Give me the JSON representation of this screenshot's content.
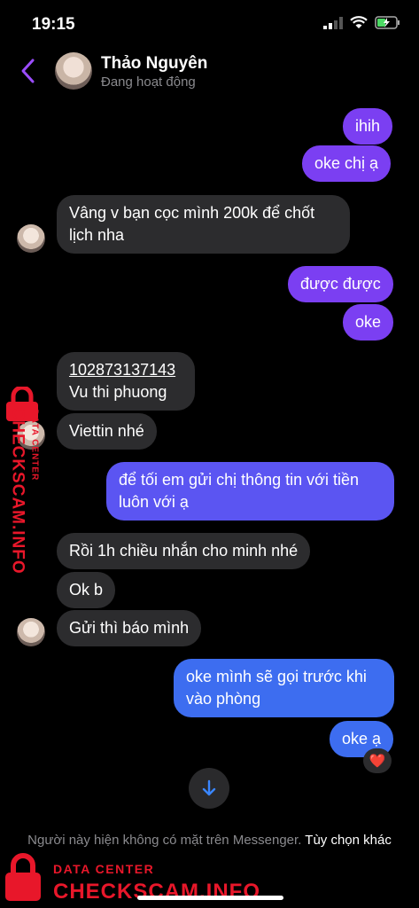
{
  "status_bar": {
    "time": "19:15"
  },
  "header": {
    "name": "Thảo Nguyên",
    "status": "Đang hoạt động"
  },
  "messages": [
    {
      "side": "out",
      "text": "ihih"
    },
    {
      "side": "out",
      "text": "oke chị ạ"
    },
    {
      "side": "in",
      "text": "Vâng v bạn cọc mình 200k để chốt lịch nha"
    },
    {
      "side": "out",
      "text": "được được"
    },
    {
      "side": "out",
      "text": "oke"
    },
    {
      "side": "in",
      "link": "102873137143",
      "text": "Vu thi phuong"
    },
    {
      "side": "in",
      "text": "Viettin nhé"
    },
    {
      "side": "out",
      "text": "để tối em gửi chị thông tin với tiền luôn với ạ"
    },
    {
      "side": "in",
      "text": "Rồi 1h chiều nhắn cho minh nhé"
    },
    {
      "side": "in",
      "text": "Ok b"
    },
    {
      "side": "in",
      "text": "Gửi thì báo mình"
    },
    {
      "side": "out",
      "text": "oke mình sẽ gọi trước khi vào phòng"
    },
    {
      "side": "out",
      "text": "oke ạ"
    }
  ],
  "reaction": "❤️",
  "footer": {
    "note": "Người này hiện không có mặt trên Messenger.",
    "option": "Tùy chọn khác"
  },
  "watermark": {
    "title": "DATA CENTER",
    "brand": "CHECKSCAM.INFO"
  },
  "colors": {
    "outgoing": "#7b3ff2",
    "incoming": "#2c2c2e",
    "accent": "#8e4dff",
    "watermark": "#e8172a"
  }
}
